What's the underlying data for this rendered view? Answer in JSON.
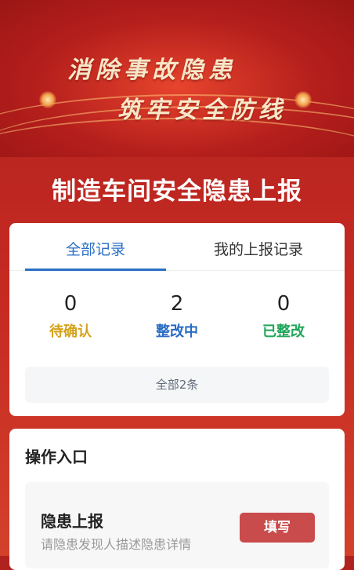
{
  "banner": {
    "slogan_line1": "消除事故隐患",
    "slogan_line2": "筑牢安全防线"
  },
  "page_title": "制造车间安全隐患上报",
  "tabs": [
    {
      "label": "全部记录",
      "active": true
    },
    {
      "label": "我的上报记录",
      "active": false
    }
  ],
  "stats": [
    {
      "value": "0",
      "label": "待确认",
      "color": "#d4a21a"
    },
    {
      "value": "2",
      "label": "整改中",
      "color": "#2a6bc4"
    },
    {
      "value": "0",
      "label": "已整改",
      "color": "#20a65a"
    }
  ],
  "total_text": "全部2条",
  "operations": {
    "title": "操作入口",
    "entry": {
      "title": "隐患上报",
      "description": "请隐患发现人描述隐患详情",
      "button_label": "填写"
    }
  }
}
